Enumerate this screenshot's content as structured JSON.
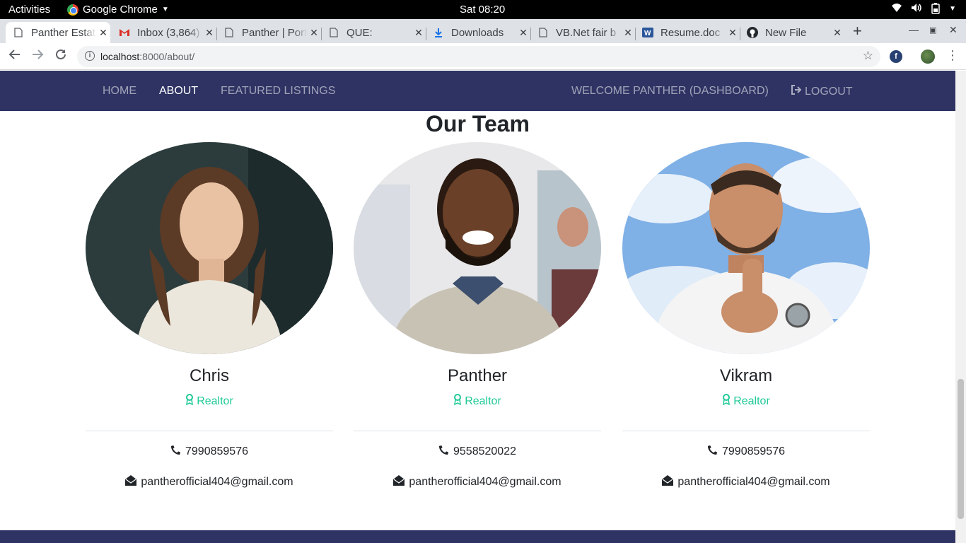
{
  "system_bar": {
    "activities": "Activities",
    "app_name": "Google Chrome",
    "clock": "Sat 08:20"
  },
  "tabs": [
    {
      "title": "Panther Estate",
      "icon": "page-icon",
      "active": true
    },
    {
      "title": "Inbox (3,864)",
      "icon": "gmail-icon",
      "active": false
    },
    {
      "title": "Panther | Portfolio",
      "icon": "page-icon",
      "active": false
    },
    {
      "title": "QUE:",
      "icon": "page-icon",
      "active": false
    },
    {
      "title": "Downloads",
      "icon": "download-icon",
      "active": false
    },
    {
      "title": "VB.Net fair b",
      "icon": "page-icon",
      "active": false
    },
    {
      "title": "Resume.doc",
      "icon": "word-icon",
      "active": false
    },
    {
      "title": "New File",
      "icon": "github-icon",
      "active": false
    }
  ],
  "omnibox": {
    "host": "localhost",
    "path": ":8000/about/"
  },
  "nav": {
    "home": "HOME",
    "about": "ABOUT",
    "featured": "FEATURED LISTINGS",
    "welcome": "WELCOME PANTHER (DASHBOARD)",
    "logout": "LOGOUT"
  },
  "team": {
    "title": "Our Team",
    "members": [
      {
        "name": "Chris",
        "role": "Realtor",
        "phone": "7990859576",
        "email": "pantherofficial404@gmail.com"
      },
      {
        "name": "Panther",
        "role": "Realtor",
        "phone": "9558520022",
        "email": "pantherofficial404@gmail.com"
      },
      {
        "name": "Vikram",
        "role": "Realtor",
        "phone": "7990859576",
        "email": "pantherofficial404@gmail.com"
      }
    ]
  },
  "colors": {
    "navbar": "#2e3363",
    "accent": "#20c997"
  }
}
